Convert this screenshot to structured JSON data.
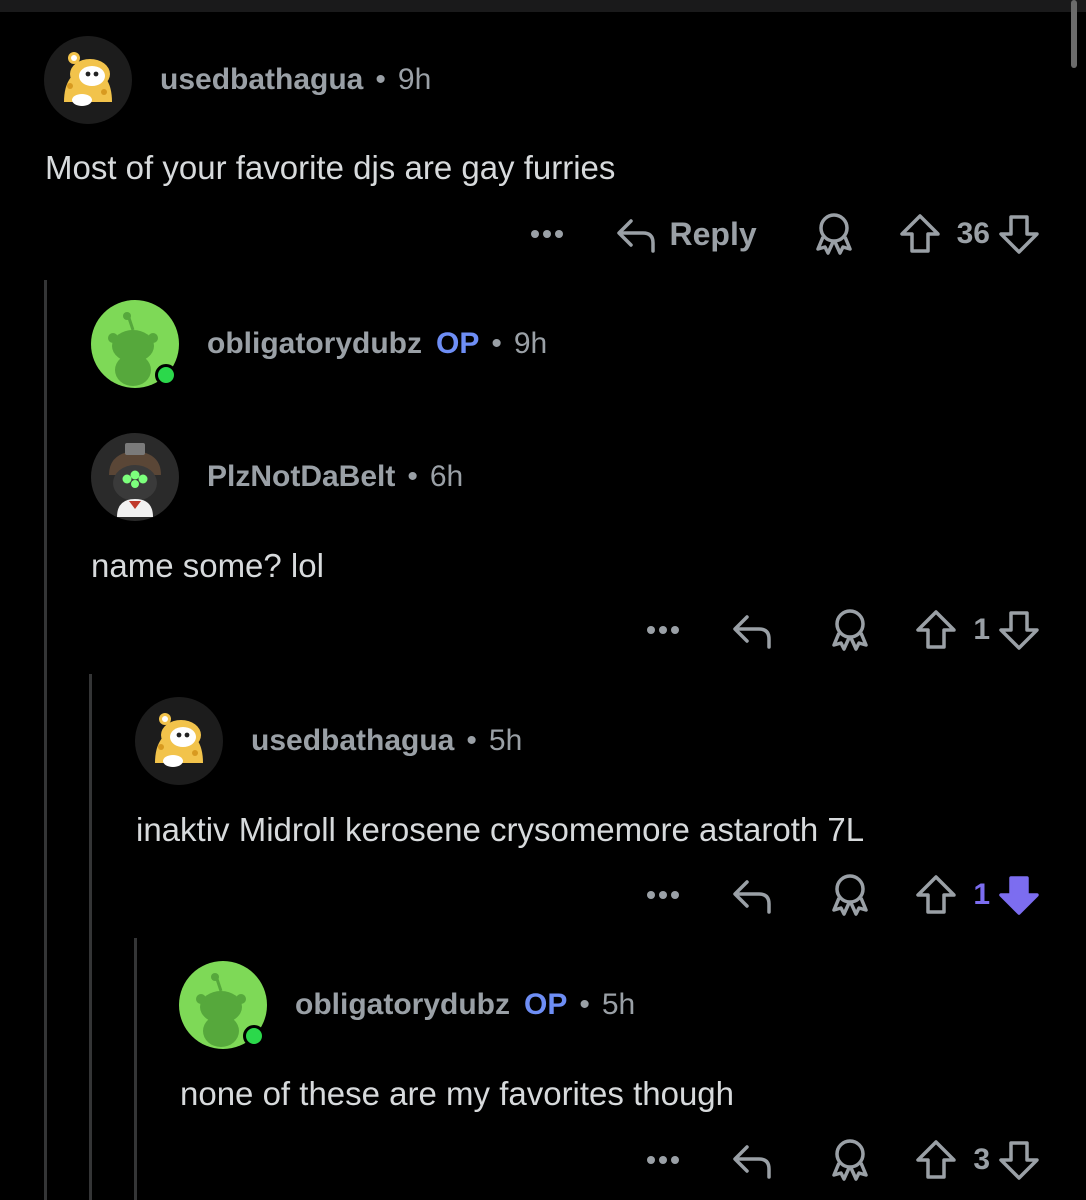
{
  "comments": [
    {
      "author": "usedbathagua",
      "op_badge": "",
      "separator": "•",
      "time": "9h",
      "text": "Most of your favorite djs are gay furries",
      "reply_label": "Reply",
      "votes": "36",
      "vote_state": "none",
      "avatar": "cheese-dog-avatar"
    },
    {
      "author": "obligatorydubz",
      "op_badge": "OP",
      "separator": "•",
      "time": "9h",
      "text": "",
      "avatar": "snoo-green-avatar",
      "online": true
    },
    {
      "author": "PlzNotDaBelt",
      "separator": "•",
      "time": "6h",
      "text": "name some? lol",
      "votes": "1",
      "vote_state": "none",
      "avatar": "night-vision-avatar"
    },
    {
      "author": "usedbathagua",
      "separator": "•",
      "time": "5h",
      "text": "inaktiv Midroll kerosene crysomemore astaroth 7L",
      "votes": "1",
      "vote_state": "downvoted",
      "avatar": "cheese-dog-avatar"
    },
    {
      "author": "obligatorydubz",
      "op_badge": "OP",
      "separator": "•",
      "time": "5h",
      "text": "none of these are my favorites though",
      "votes": "3",
      "vote_state": "none",
      "avatar": "snoo-green-avatar",
      "online": true
    }
  ],
  "colors": {
    "background": "#000000",
    "text": "#d7dadc",
    "muted": "#9aa0a6",
    "op": "#6e8ef5",
    "downvote": "#7c6df0",
    "online": "#2bd84b"
  }
}
